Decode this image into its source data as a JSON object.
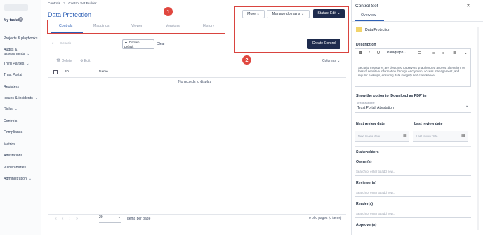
{
  "sidebar": {
    "items": [
      {
        "label": "My tasks",
        "chevron": ""
      },
      {
        "label": "Projects & playbooks",
        "chevron": ""
      },
      {
        "label": "Audits & assessments",
        "chevron": "⌄"
      },
      {
        "label": "Third Parties",
        "chevron": "⌄"
      },
      {
        "label": "Trust Portal",
        "chevron": ""
      },
      {
        "label": "Registers",
        "chevron": ""
      },
      {
        "label": "Issues & incidents",
        "chevron": "⌄"
      },
      {
        "label": "Risks",
        "chevron": "⌄"
      },
      {
        "label": "Controls",
        "chevron": ""
      },
      {
        "label": "Compliance",
        "chevron": ""
      },
      {
        "label": "Metrics",
        "chevron": ""
      },
      {
        "label": "Attestations",
        "chevron": ""
      },
      {
        "label": "Vulnerabilities",
        "chevron": ""
      },
      {
        "label": "Administration",
        "chevron": "⌄"
      }
    ],
    "badge": "2"
  },
  "breadcrumb": {
    "first": "Controls",
    "sep": ">",
    "second": "Control Set Builder"
  },
  "page_title": "Data Protection",
  "tabs": [
    "Controls",
    "Mappings",
    "Viewer",
    "Versions",
    "History"
  ],
  "callouts": {
    "one": "1",
    "two": "2"
  },
  "header_buttons": {
    "more": "More",
    "manage": "Manage domains",
    "status": "Status: Edit"
  },
  "create_control": "Create Control",
  "search": {
    "placeholder": "Search"
  },
  "filter": {
    "line1": "Domain",
    "line2": "Default"
  },
  "clear": "Clear",
  "actions": {
    "delete": "Delete",
    "edit": "Edit"
  },
  "columns_label": "Columns",
  "table": {
    "col_id": "ID",
    "col_name": "Name",
    "empty": "No records to display"
  },
  "footer": {
    "per_page_value": "20",
    "per_page_label": "Items per page",
    "pager_text": "0 of 0 pages (0 items)"
  },
  "panel": {
    "title": "Control Set",
    "tab": "Overview",
    "name": "Data Protection",
    "description_label": "Description",
    "toolbar": {
      "bold": "B",
      "italic": "I",
      "underline": "U",
      "paragraph": "Paragraph"
    },
    "description_text": "Security measures are designed to prevent unauthorized access, alteration, or loss of sensitive information through encryption, access management, and regular backups, ensuring data integrity and compliance.",
    "download_label": "Show the option to 'Download as PDF' in",
    "select_small": "Areas available",
    "select_value": "Trust Portal, Attestation",
    "next_review": "Next review date",
    "last_review": "Last review date",
    "next_ph": "Next review date",
    "last_ph": "Last review date",
    "stakeholders": "Stakeholders",
    "owners": "Owner(s)",
    "owners_ph": "Search or enter to add new...",
    "reviewers": "Reviewer(s)",
    "reviewers_ph": "Search or enter to add new...",
    "readers": "Reader(s)",
    "readers_ph": "Search or enter to add new...",
    "approvers": "Approver(s)"
  },
  "colors": {
    "accent": "#2d5fb5",
    "callout": "#e0473f",
    "dark_button": "#1e2b4d"
  }
}
